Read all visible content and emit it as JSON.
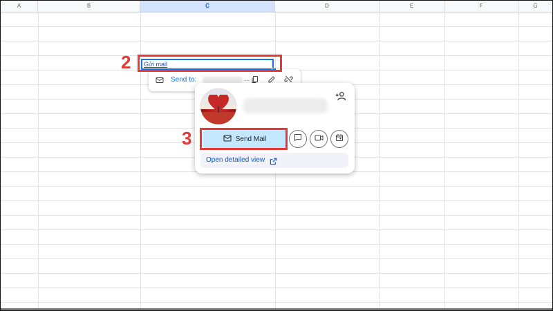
{
  "columns": [
    "A",
    "B",
    "C",
    "D",
    "E",
    "F",
    "G"
  ],
  "selected_column": "C",
  "cell": {
    "link_text": "Gửi mail"
  },
  "link_chip": {
    "send_to_label": "Send to:",
    "ellipsis": "..."
  },
  "card": {
    "send_mail_label": "Send Mail",
    "open_detailed_label": "Open detailed view"
  },
  "annotations": {
    "step2": "2",
    "step3": "3"
  },
  "colors": {
    "accent": "#1a73e8",
    "highlight": "#e53935",
    "send_button_bg": "#c2e7ff"
  },
  "icons": [
    "mail-icon",
    "copy-icon",
    "edit-icon",
    "unlink-icon",
    "add-person-icon",
    "chat-icon",
    "video-icon",
    "calendar-icon",
    "external-link-icon"
  ]
}
